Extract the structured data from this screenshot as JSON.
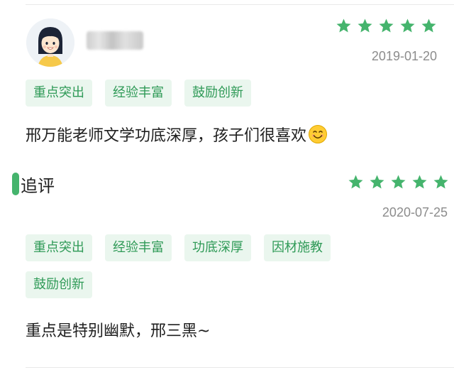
{
  "review": {
    "username": "",
    "rating": 5,
    "date": "2019-01-20",
    "tags": [
      "重点突出",
      "经验丰富",
      "鼓励创新"
    ],
    "text": "邢万能老师文学功底深厚，孩子们很喜欢",
    "emoji": "smiling-face-emoji"
  },
  "followup": {
    "label": "追评",
    "rating": 5,
    "date": "2020-07-25",
    "tags": [
      "重点突出",
      "经验丰富",
      "功底深厚",
      "因材施教",
      "鼓励创新"
    ],
    "text": "重点是特别幽默，邢三黑~"
  },
  "colors": {
    "star": "#45b46d",
    "tag_bg": "#eaf6ee",
    "tag_text": "#2f9a57",
    "date_text": "#8c8c8c",
    "accent_bar": "#45b46d"
  },
  "icons": {
    "star": "star-icon",
    "avatar": "girl-avatar-icon"
  }
}
